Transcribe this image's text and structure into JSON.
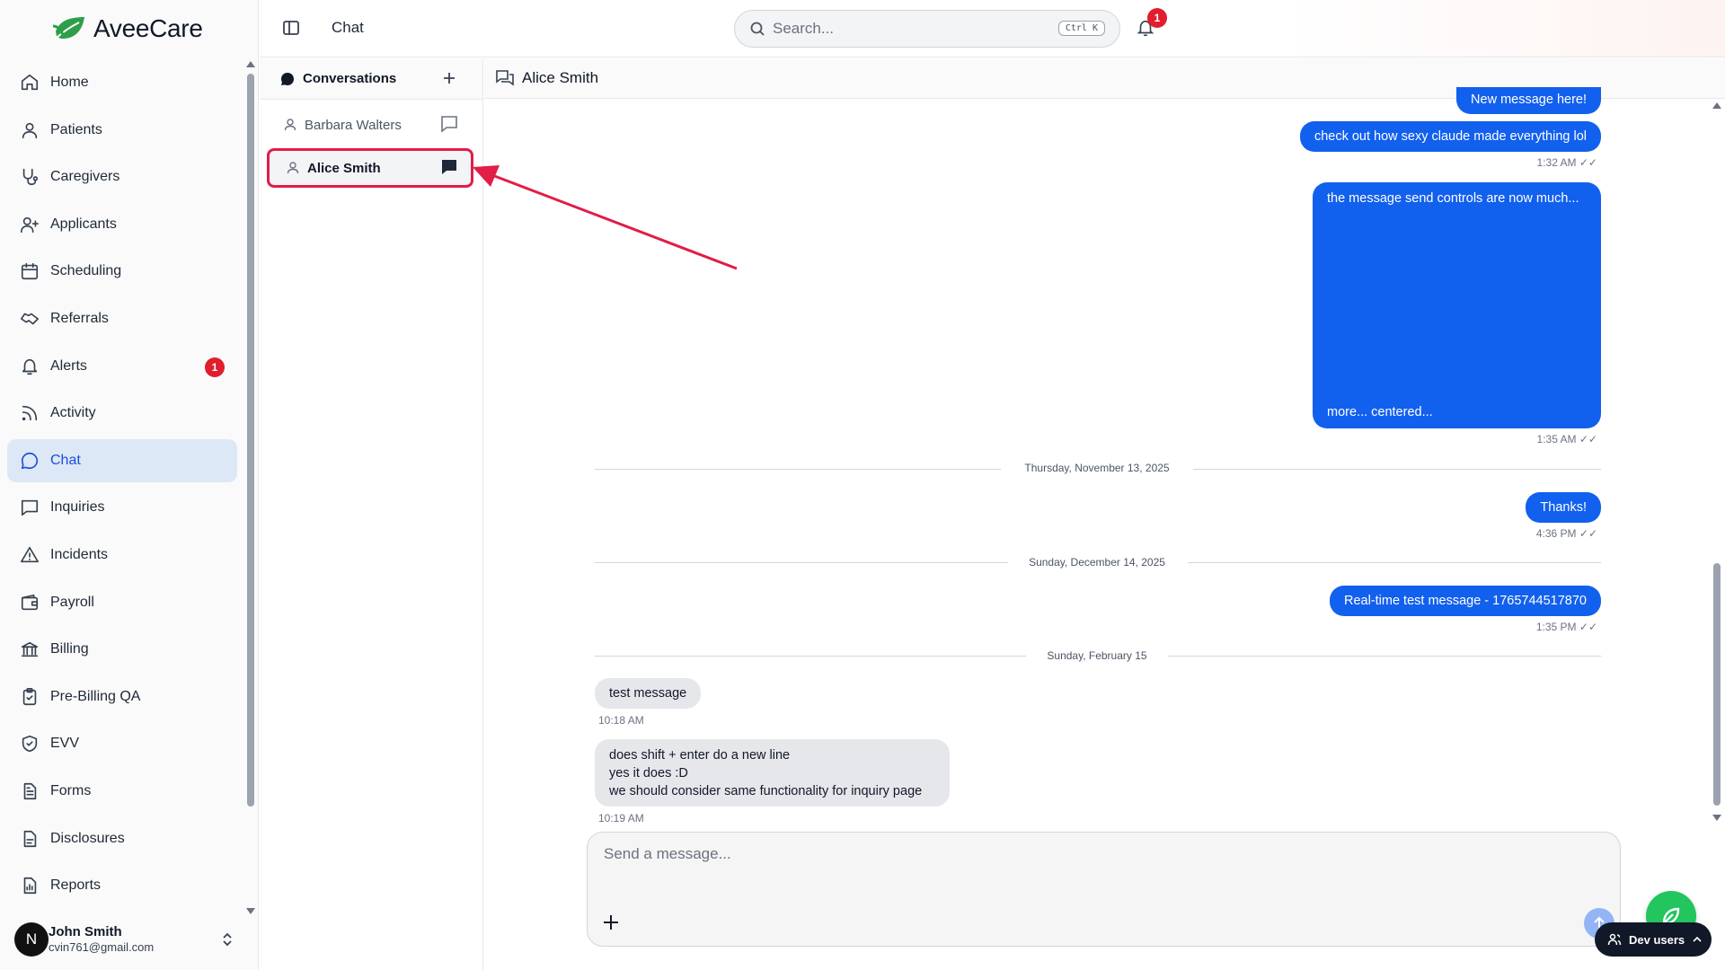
{
  "app": {
    "name": "AveeCare"
  },
  "topbar": {
    "title": "Chat",
    "search_placeholder": "Search...",
    "search_shortcut": "Ctrl K",
    "notification_count": "1"
  },
  "sidebar": {
    "items": [
      {
        "label": "Home",
        "icon": "home-icon"
      },
      {
        "label": "Patients",
        "icon": "user-icon"
      },
      {
        "label": "Caregivers",
        "icon": "stethoscope-icon"
      },
      {
        "label": "Applicants",
        "icon": "user-plus-icon"
      },
      {
        "label": "Scheduling",
        "icon": "calendar-icon"
      },
      {
        "label": "Referrals",
        "icon": "handshake-icon"
      },
      {
        "label": "Alerts",
        "icon": "bell-icon",
        "badge": "1"
      },
      {
        "label": "Activity",
        "icon": "rss-icon"
      },
      {
        "label": "Chat",
        "icon": "chat-icon",
        "active": true
      },
      {
        "label": "Inquiries",
        "icon": "message-square-icon"
      },
      {
        "label": "Incidents",
        "icon": "warning-icon"
      },
      {
        "label": "Payroll",
        "icon": "wallet-icon"
      },
      {
        "label": "Billing",
        "icon": "bank-icon"
      },
      {
        "label": "Pre-Billing QA",
        "icon": "clipboard-check-icon"
      },
      {
        "label": "EVV",
        "icon": "shield-check-icon"
      },
      {
        "label": "Forms",
        "icon": "file-text-icon"
      },
      {
        "label": "Disclosures",
        "icon": "file-icon"
      },
      {
        "label": "Reports",
        "icon": "report-icon"
      }
    ],
    "user": {
      "initial": "N",
      "name": "John Smith",
      "email": "cvin761@gmail.com"
    }
  },
  "conversations": {
    "title": "Conversations",
    "items": [
      {
        "name": "Barbara Walters",
        "selected": false
      },
      {
        "name": "Alice Smith",
        "selected": true
      }
    ]
  },
  "chat": {
    "title": "Alice Smith",
    "messages": [
      {
        "text": "New message here!",
        "time": ""
      },
      {
        "text": "check out how sexy claude made everything lol",
        "time": "1:32 AM ✓✓"
      },
      {
        "text_top": "the message send controls are now much...",
        "text_bottom": "more... centered...",
        "time": "1:35 AM ✓✓"
      },
      {
        "text": "Thanks!",
        "time": "4:36 PM ✓✓"
      },
      {
        "text": "Real-time test message - 1765744517870",
        "time": "1:35 PM ✓✓"
      },
      {
        "text": "test message",
        "time": "10:18 AM"
      },
      {
        "line1": "does shift + enter do a new line",
        "line2": "yes it does :D",
        "line3": "we should consider same functionality for inquiry page",
        "time": "10:19 AM"
      }
    ],
    "separators": [
      "Thursday, November 13, 2025",
      "Sunday, December 14, 2025",
      "Sunday, February 15"
    ],
    "composer_placeholder": "Send a message..."
  },
  "dev_users_label": "Dev users",
  "colors": {
    "accent": "#1260ee",
    "badge": "#e11d2e",
    "annotation": "#e11d48",
    "fab": "#22c55e"
  }
}
